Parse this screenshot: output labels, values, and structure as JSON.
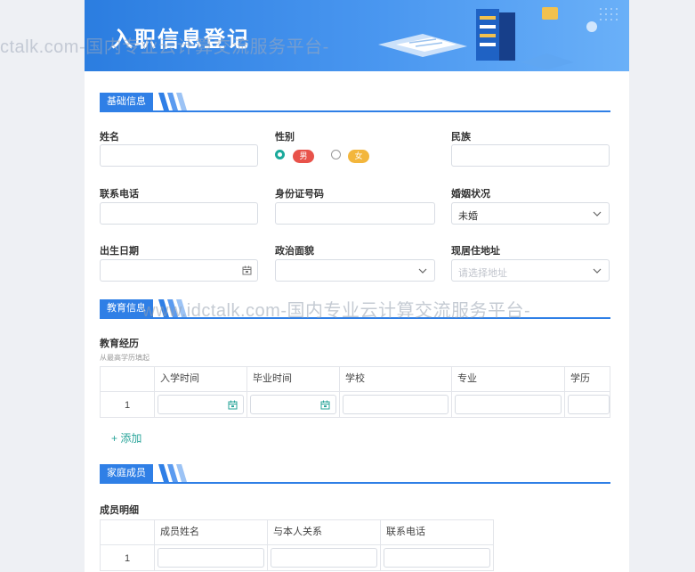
{
  "watermarks": {
    "top": "ctalk.com-国内专业云计算交流服务平台-",
    "middle": "www.idctalk.com-国内专业云计算交流服务平台-"
  },
  "banner": {
    "title": "入职信息登记"
  },
  "sections": {
    "basic": "基础信息",
    "education": "教育信息",
    "family": "家庭成员"
  },
  "basic": {
    "name_label": "姓名",
    "gender_label": "性别",
    "gender_options": [
      "男",
      "女"
    ],
    "gender_selected": "男",
    "ethnicity_label": "民族",
    "phone_label": "联系电话",
    "id_label": "身份证号码",
    "marital_label": "婚姻状况",
    "marital_value": "未婚",
    "birth_label": "出生日期",
    "political_label": "政治面貌",
    "address_label": "现居住地址",
    "address_placeholder": "请选择地址"
  },
  "education": {
    "label": "教育经历",
    "sublabel": "从最高学历填起",
    "columns": [
      "入学时间",
      "毕业时间",
      "学校",
      "专业",
      "学历"
    ],
    "rows": [
      "1"
    ],
    "add_label": "+ 添加"
  },
  "family": {
    "label": "成员明细",
    "columns": [
      "成员姓名",
      "与本人关系",
      "联系电话"
    ],
    "rows": [
      "1"
    ]
  },
  "colors": {
    "accent": "#2f7fe6",
    "teal": "#1aa99b",
    "male": "#e8524a",
    "female": "#f3b63c"
  }
}
